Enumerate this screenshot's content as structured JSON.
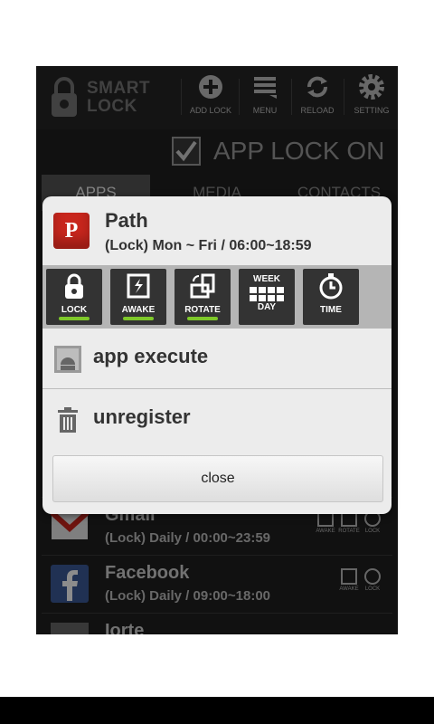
{
  "app": {
    "logo_line1": "SMART",
    "logo_line2": "LOCK"
  },
  "toolbar": {
    "add_lock": "ADD LOCK",
    "menu": "MENU",
    "reload": "RELOAD",
    "setting": "SETTING"
  },
  "lock_status": {
    "label": "APP LOCK ON",
    "checked": true
  },
  "tabs": [
    "APPS",
    "MEDIA",
    "CONTACTS"
  ],
  "list": [
    {
      "name": "Gmail",
      "schedule": "(Lock) Daily / 00:00~23:59",
      "badges": [
        "AWAKE",
        "ROTATE",
        "LOCK"
      ]
    },
    {
      "name": "Facebook",
      "schedule": "(Lock) Daily / 09:00~18:00",
      "badges": [
        "AWAKE",
        "LOCK"
      ]
    },
    {
      "name": "Iorte",
      "schedule": "",
      "badges": []
    }
  ],
  "dialog": {
    "app_name": "Path",
    "app_icon_letter": "P",
    "schedule": "(Lock) Mon ~ Fri / 06:00~18:59",
    "options": [
      {
        "label": "LOCK",
        "active": true
      },
      {
        "label": "AWAKE",
        "active": true
      },
      {
        "label": "ROTATE",
        "active": true
      },
      {
        "label_top": "WEEK",
        "label": "DAY",
        "active": false
      },
      {
        "label": "TIME",
        "active": false
      }
    ],
    "execute_label": "app execute",
    "unregister_label": "unregister",
    "close_label": "close"
  },
  "colors": {
    "accent_green": "#7ec82a",
    "path_red": "#c8261d",
    "dialog_bg": "#ececec"
  }
}
